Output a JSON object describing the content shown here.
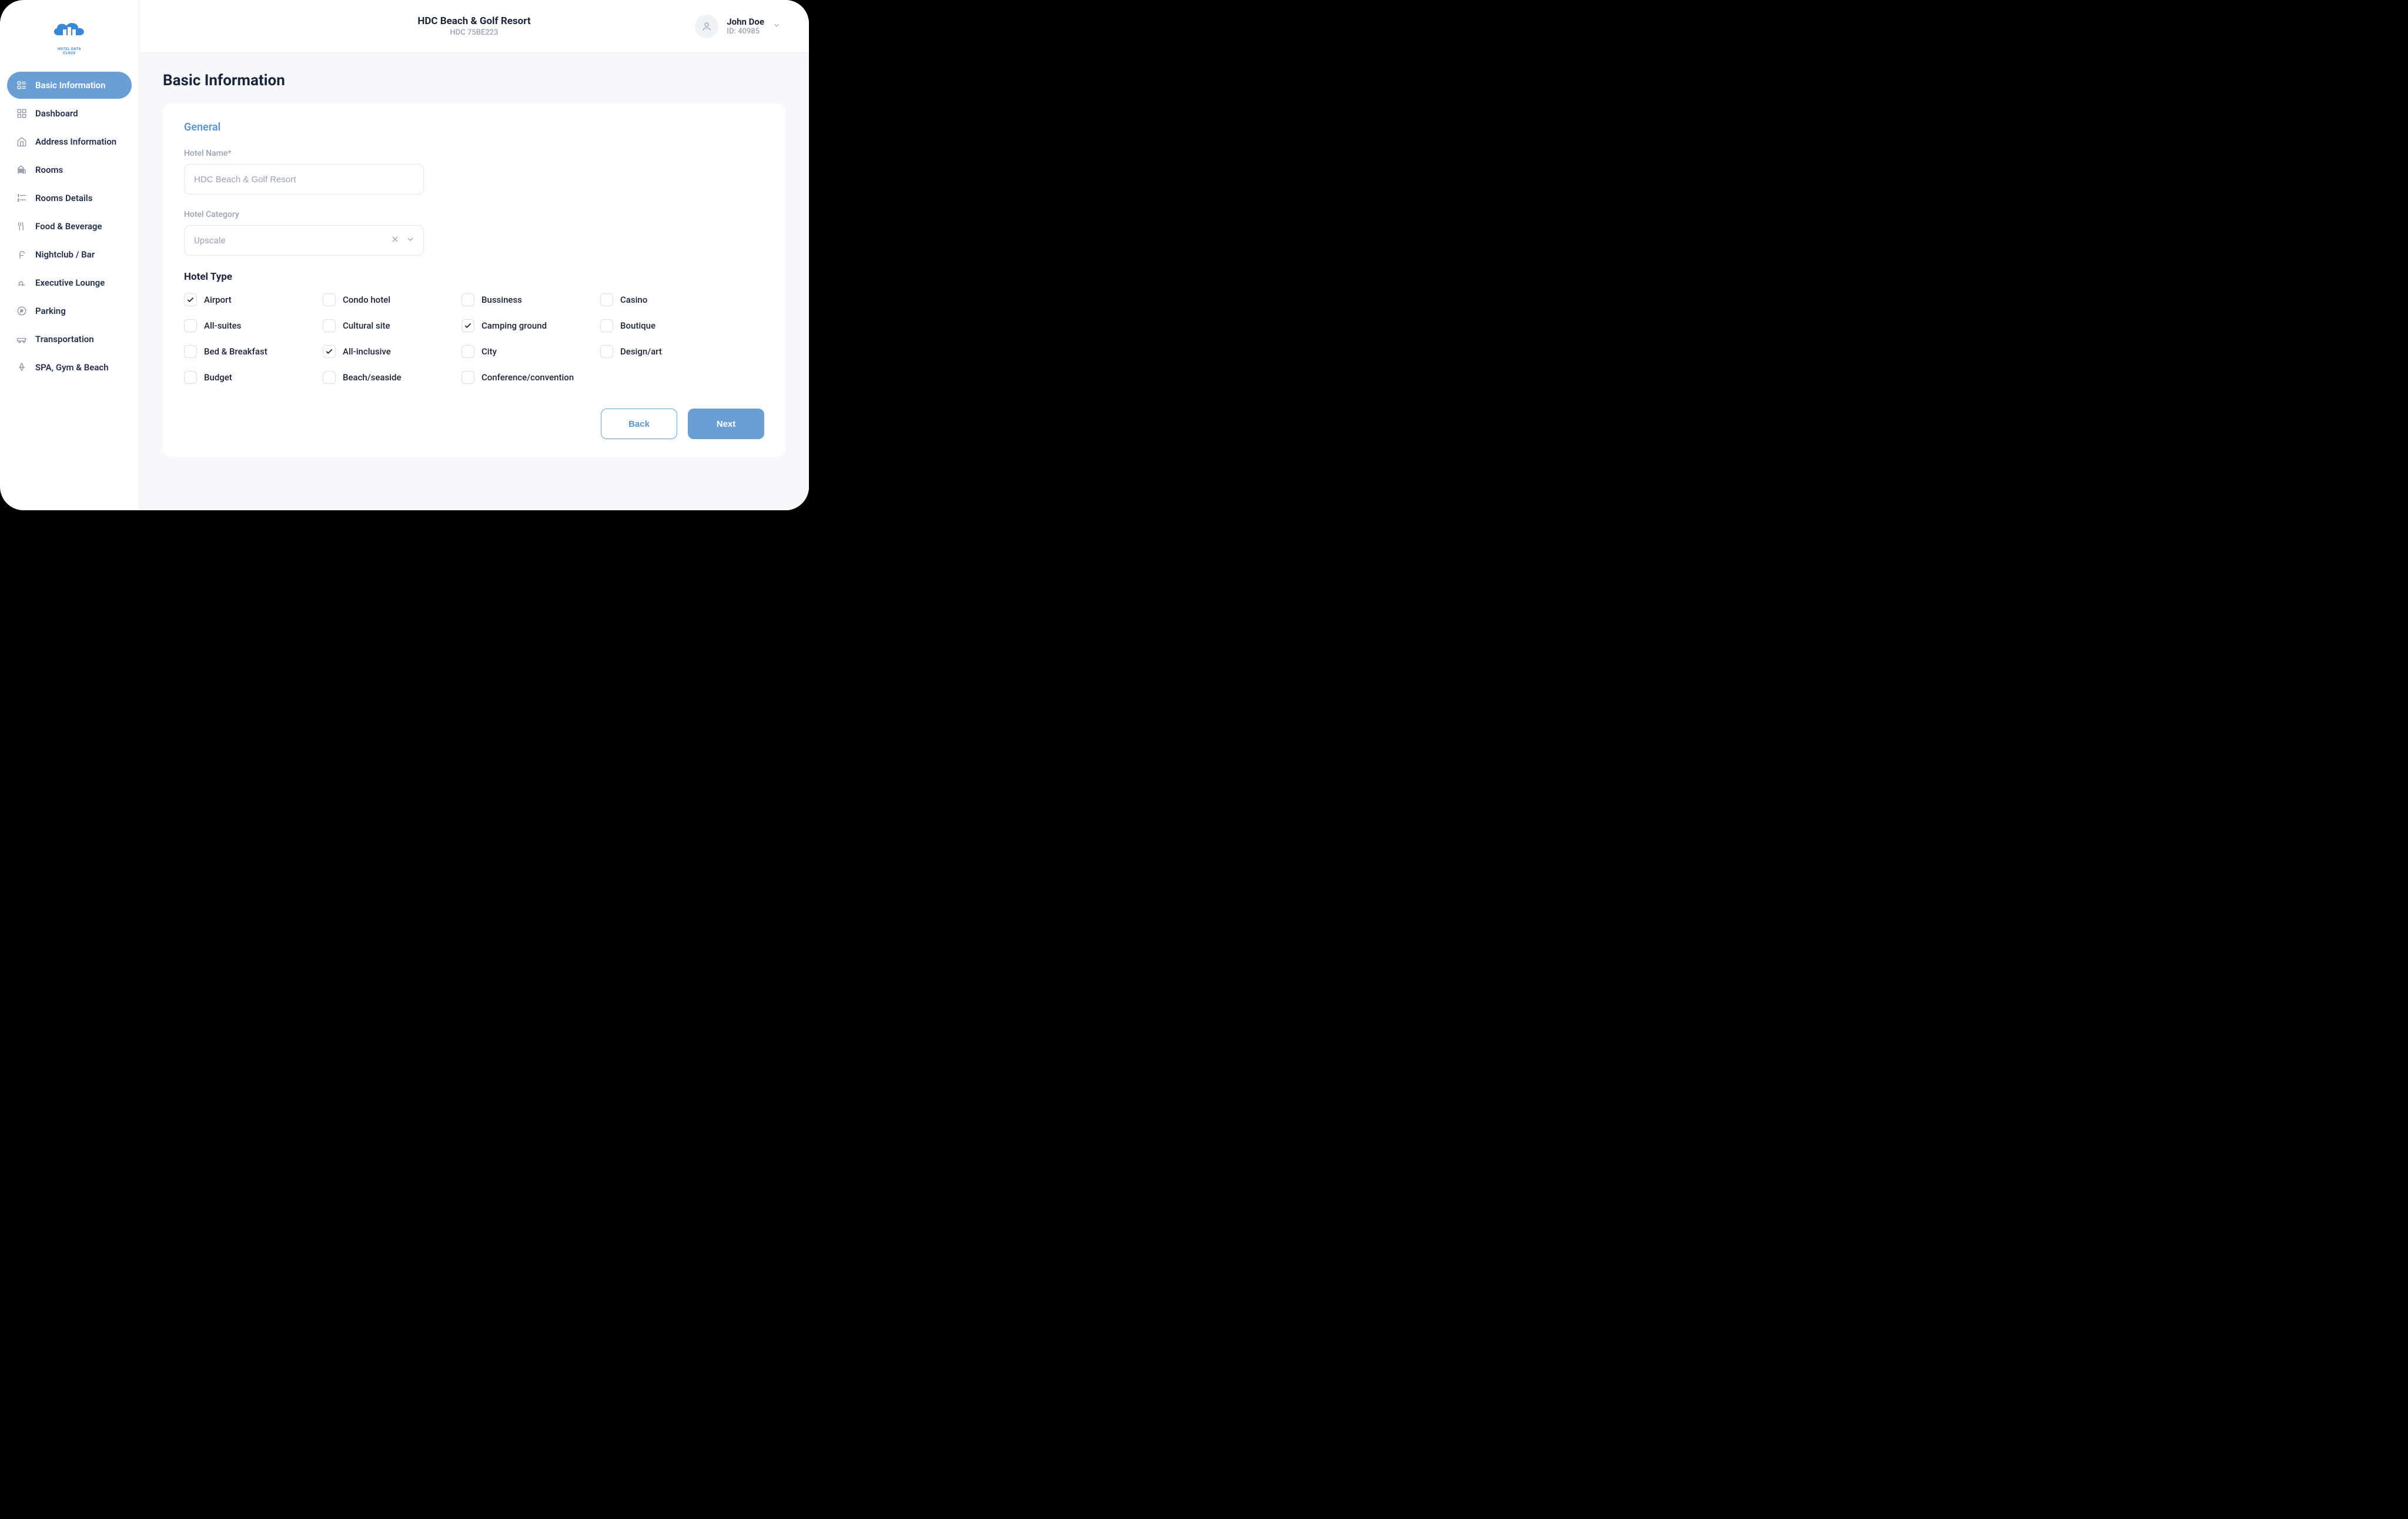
{
  "logo": {
    "line1": "HOTEL DATA",
    "line2": "CLOUD"
  },
  "sidebar": {
    "items": [
      {
        "label": "Basic Information",
        "active": true
      },
      {
        "label": "Dashboard"
      },
      {
        "label": "Address Information"
      },
      {
        "label": "Rooms"
      },
      {
        "label": "Rooms Details"
      },
      {
        "label": "Food & Beverage"
      },
      {
        "label": "Nightclub / Bar"
      },
      {
        "label": "Executive Lounge"
      },
      {
        "label": "Parking"
      },
      {
        "label": "Transportation"
      },
      {
        "label": "SPA, Gym & Beach"
      }
    ]
  },
  "header": {
    "title": "HDC Beach & Golf Resort",
    "subtitle": "HDC 75BE223",
    "user": {
      "name": "John Doe",
      "id_label": "ID: 40985"
    }
  },
  "page": {
    "title": "Basic Information"
  },
  "form": {
    "section_general": "General",
    "hotel_name": {
      "label": "Hotel Name*",
      "placeholder": "HDC Beach & Golf Resort"
    },
    "hotel_category": {
      "label": "Hotel Category",
      "value": "Upscale"
    },
    "hotel_type": {
      "heading": "Hotel Type",
      "options": [
        {
          "label": "Airport",
          "checked": true
        },
        {
          "label": "Condo hotel",
          "checked": false
        },
        {
          "label": "Bussiness",
          "checked": false
        },
        {
          "label": "Casino",
          "checked": false
        },
        {
          "label": "All-suites",
          "checked": false
        },
        {
          "label": "Cultural site",
          "checked": false
        },
        {
          "label": "Camping ground",
          "checked": true
        },
        {
          "label": "Boutique",
          "checked": false
        },
        {
          "label": "Bed & Breakfast",
          "checked": false
        },
        {
          "label": "All-inclusive",
          "checked": true
        },
        {
          "label": "City",
          "checked": false
        },
        {
          "label": "Design/art",
          "checked": false
        },
        {
          "label": "Budget",
          "checked": false
        },
        {
          "label": "Beach/seaside",
          "checked": false
        },
        {
          "label": "Conference/convention",
          "checked": false
        }
      ]
    },
    "buttons": {
      "back": "Back",
      "next": "Next"
    }
  }
}
